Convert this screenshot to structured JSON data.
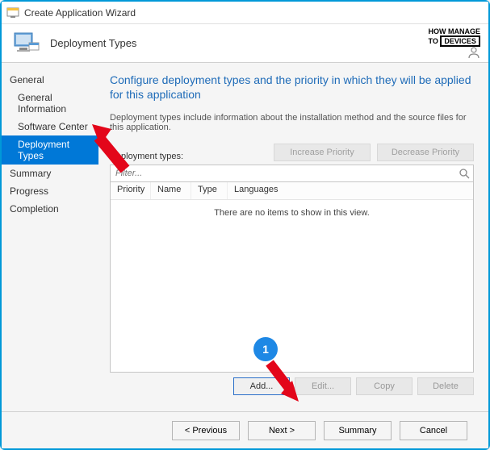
{
  "window": {
    "title": "Create Application Wizard"
  },
  "banner": {
    "title": "Deployment Types",
    "brand_how": "HOW",
    "brand_to": "TO",
    "brand_manage": "MANAGE",
    "brand_devices": "DEVICES"
  },
  "nav": {
    "general": "General",
    "general_info": "General Information",
    "software_center": "Software Center",
    "deployment_types": "Deployment Types",
    "summary": "Summary",
    "progress": "Progress",
    "completion": "Completion"
  },
  "main": {
    "heading": "Configure deployment types and the priority in which they will be applied for this application",
    "description": "Deployment types include information about the installation method and the source files for this application.",
    "section_label": "Deployment types:",
    "increase_priority": "Increase Priority",
    "decrease_priority": "Decrease Priority",
    "filter_placeholder": "Filter...",
    "cols": {
      "priority": "Priority",
      "name": "Name",
      "type": "Type",
      "languages": "Languages"
    },
    "empty": "There are no items to show in this view.",
    "add": "Add...",
    "edit": "Edit...",
    "copy": "Copy",
    "delete": "Delete"
  },
  "footer": {
    "previous": "< Previous",
    "next": "Next >",
    "summary": "Summary",
    "cancel": "Cancel"
  },
  "annotations": {
    "badge1": "1"
  }
}
